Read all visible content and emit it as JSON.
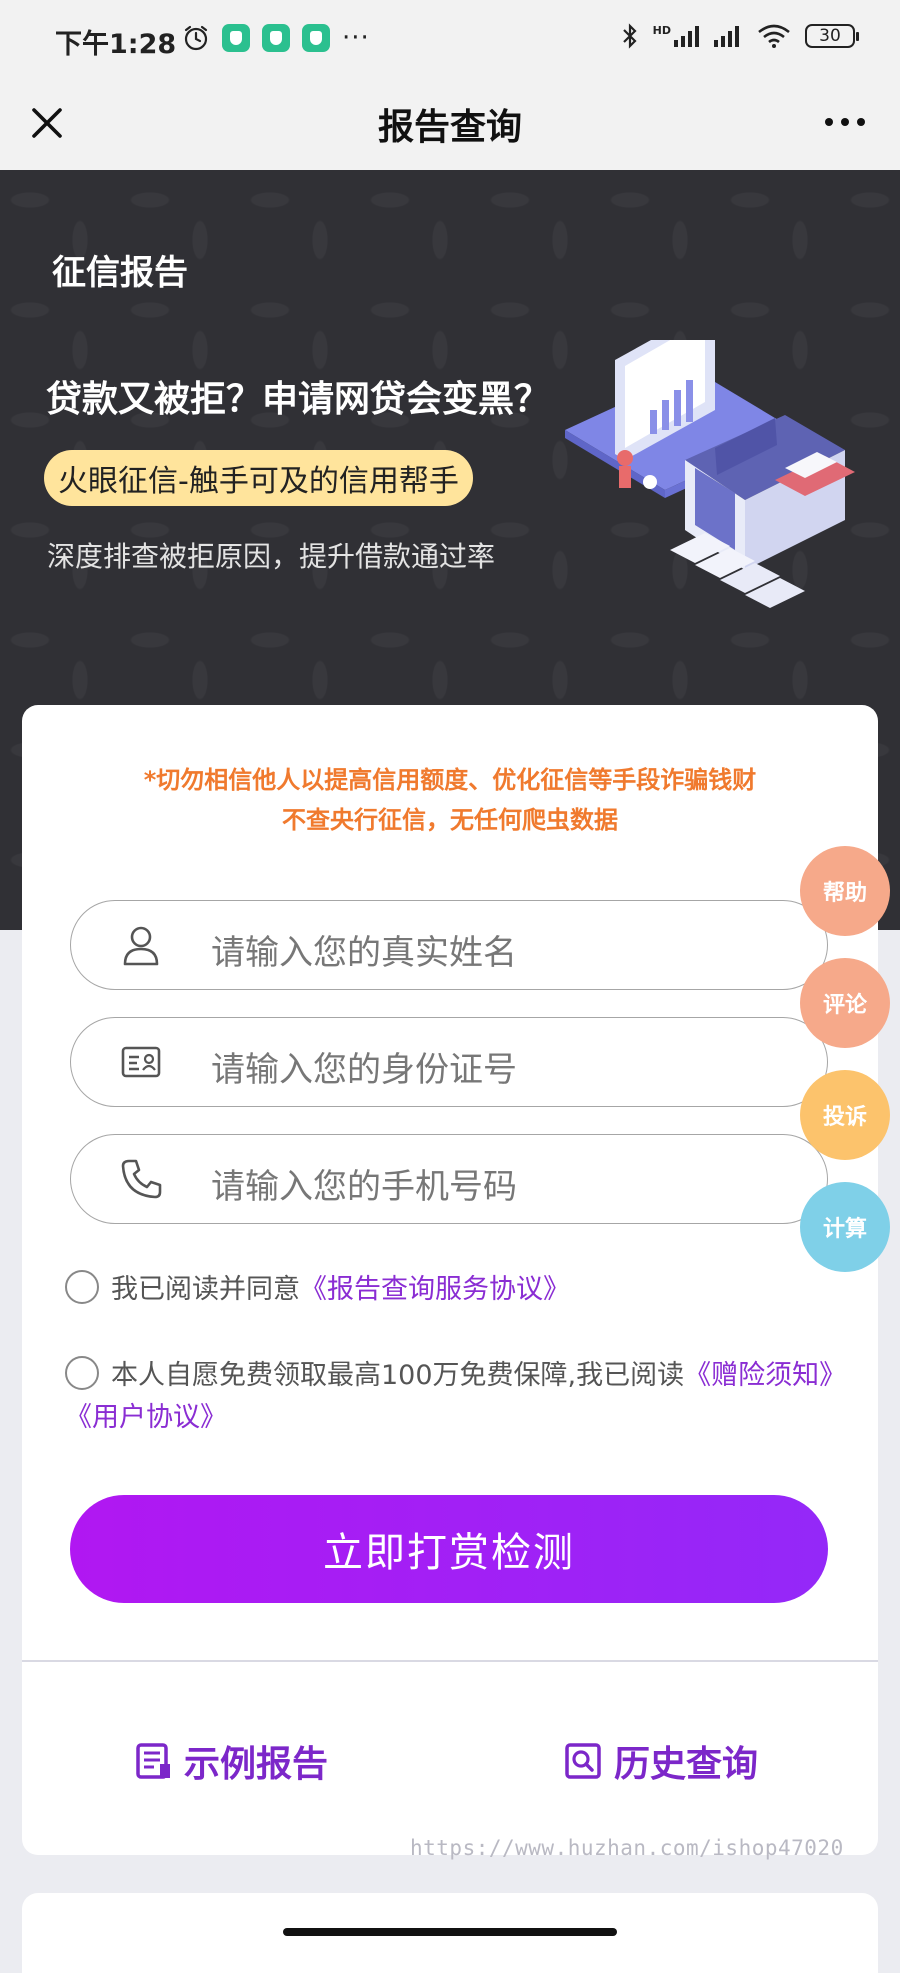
{
  "status_bar": {
    "time": "下午1:28",
    "overflow": "···",
    "network": "HD",
    "battery": "30"
  },
  "nav": {
    "title": "报告查询",
    "close_icon": "close-icon",
    "more_icon": "more-dots-icon"
  },
  "hero": {
    "label": "征信报告",
    "headline": "贷款又被拒？申请网贷会变黑？",
    "pill": "火眼征信-触手可及的信用帮手",
    "subtitle": "深度排查被拒原因，提升借款通过率"
  },
  "form": {
    "warning_line1": "*切勿相信他人以提高信用额度、优化征信等手段诈骗钱财",
    "warning_line2": "不查央行征信，无任何爬虫数据",
    "name_placeholder": "请输入您的真实姓名",
    "id_placeholder": "请输入您的身份证号",
    "phone_placeholder": "请输入您的手机号码",
    "agree1_text": "我已阅读并同意",
    "agree1_link": "《报告查询服务协议》",
    "agree2_text": "本人自愿免费领取最高100万免费保障,我已阅读",
    "agree2_link1": "《赠险须知》",
    "agree2_link2": "《用户协议》",
    "submit_label": "立即打赏检测",
    "sample_report": "示例报告",
    "history_query": "历史查询"
  },
  "side_buttons": [
    {
      "label": "帮助",
      "color": "#f6a98a"
    },
    {
      "label": "评论",
      "color": "#f6a98a"
    },
    {
      "label": "投诉",
      "color": "#fcc36c"
    },
    {
      "label": "计算",
      "color": "#7fd0e8"
    }
  ],
  "colors": {
    "accent": "#9428f8",
    "link": "#8a2dd3",
    "warning": "#f07a2e",
    "pill": "#ffe49c"
  },
  "watermark": "https://www.huzhan.com/ishop47020"
}
